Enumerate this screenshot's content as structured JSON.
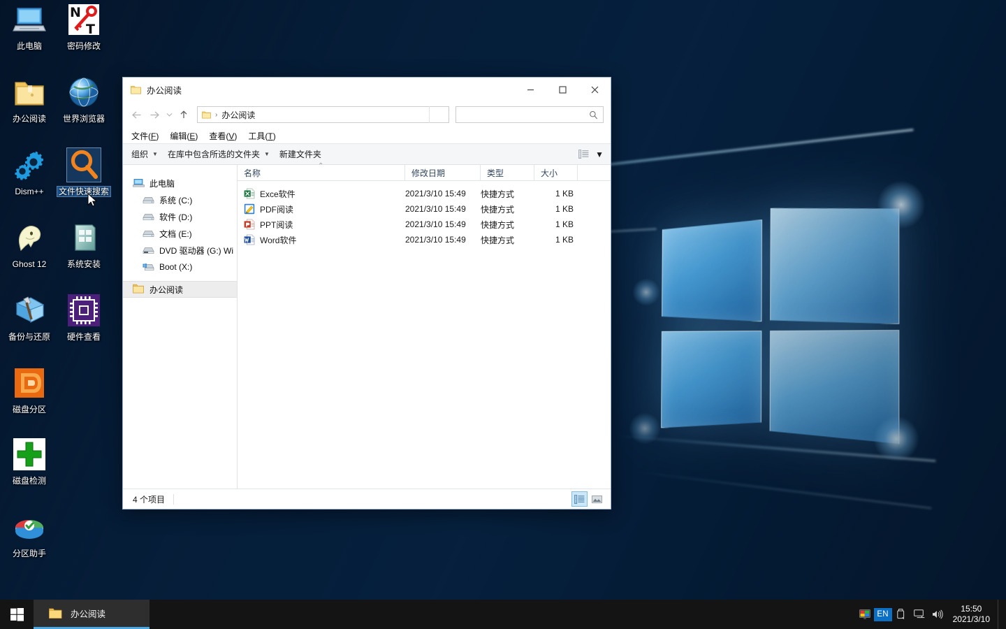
{
  "desktop": {
    "icons": [
      {
        "label": "此电脑",
        "icon": "this-pc-icon",
        "selected": false
      },
      {
        "label": "密码修改",
        "icon": "password-reset-icon",
        "selected": false
      },
      {
        "label": "办公阅读",
        "icon": "folder-icon",
        "selected": false
      },
      {
        "label": "世界浏览器",
        "icon": "globe-browser-icon",
        "selected": false
      },
      {
        "label": "Dism++",
        "icon": "gears-icon",
        "selected": false
      },
      {
        "label": "文件快速搜索",
        "icon": "magnifier-search-icon",
        "selected": true
      },
      {
        "label": "Ghost 12",
        "icon": "ghost-icon",
        "selected": false
      },
      {
        "label": "系统安装",
        "icon": "system-install-icon",
        "selected": false
      },
      {
        "label": "备份与还原",
        "icon": "backup-restore-hammer-icon",
        "selected": false
      },
      {
        "label": "硬件查看",
        "icon": "cpu-chip-icon",
        "selected": false
      },
      {
        "label": "磁盘分区",
        "icon": "disk-partition-icon",
        "selected": false
      },
      {
        "label": "磁盘检测",
        "icon": "green-cross-disk-check-icon",
        "selected": false
      },
      {
        "label": "分区助手",
        "icon": "partition-assistant-pie-icon",
        "selected": false
      }
    ]
  },
  "explorer": {
    "title": "办公阅读",
    "title_icon": "folder-icon",
    "window_controls": {
      "minimize": "—",
      "maximize": "□",
      "close": "✕"
    },
    "nav": {
      "back": "←",
      "forward": "→",
      "recent": "⌄",
      "up": "↑"
    },
    "address": {
      "icon": "folder-icon",
      "separator": "›",
      "crumb": "办公阅读"
    },
    "search": {
      "placeholder": "",
      "value": "",
      "icon": "search-icon"
    },
    "menubar": [
      {
        "text": "文件",
        "accel": "F"
      },
      {
        "text": "编辑",
        "accel": "E"
      },
      {
        "text": "查看",
        "accel": "V"
      },
      {
        "text": "工具",
        "accel": "T"
      }
    ],
    "commandbar": {
      "organize": "组织",
      "include_in_library": "在库中包含所选的文件夹",
      "new_folder": "新建文件夹",
      "caret": "▼",
      "view_icon": "view-options-icon"
    },
    "navpane": [
      {
        "label": "此电脑",
        "icon": "this-pc-icon",
        "indent": false,
        "selected": false
      },
      {
        "label": "系统 (C:)",
        "icon": "drive-icon",
        "indent": true,
        "selected": false
      },
      {
        "label": "软件 (D:)",
        "icon": "drive-icon",
        "indent": true,
        "selected": false
      },
      {
        "label": "文档 (E:)",
        "icon": "drive-icon",
        "indent": true,
        "selected": false
      },
      {
        "label": "DVD 驱动器 (G:) Wi",
        "icon": "dvd-drive-icon",
        "indent": true,
        "selected": false
      },
      {
        "label": "Boot (X:)",
        "icon": "boot-drive-icon",
        "indent": true,
        "selected": false
      },
      {
        "label": "办公阅读",
        "icon": "folder-icon",
        "indent": false,
        "selected": true
      }
    ],
    "columns": [
      {
        "key": "name",
        "label": "名称"
      },
      {
        "key": "date",
        "label": "修改日期"
      },
      {
        "key": "type",
        "label": "类型"
      },
      {
        "key": "size",
        "label": "大小"
      }
    ],
    "sort_indicator": "⌃",
    "files": [
      {
        "name": "Exce软件",
        "date": "2021/3/10 15:49",
        "type": "快捷方式",
        "size": "1 KB",
        "icon": "excel-icon"
      },
      {
        "name": "PDF阅读",
        "date": "2021/3/10 15:49",
        "type": "快捷方式",
        "size": "1 KB",
        "icon": "pdf-icon"
      },
      {
        "name": "PPT阅读",
        "date": "2021/3/10 15:49",
        "type": "快捷方式",
        "size": "1 KB",
        "icon": "powerpoint-icon"
      },
      {
        "name": "Word软件",
        "date": "2021/3/10 15:49",
        "type": "快捷方式",
        "size": "1 KB",
        "icon": "word-icon"
      }
    ],
    "status": {
      "count_text": "4 个项目",
      "view_details": "details-view-icon",
      "view_large": "large-icons-view-icon",
      "active_view": "details"
    }
  },
  "taskbar": {
    "start": "start-windows-icon",
    "tasks": [
      {
        "label": "办公阅读",
        "icon": "folder-icon",
        "active": true
      }
    ],
    "tray": [
      {
        "name": "color-picker-icon"
      },
      {
        "name": "language-indicator",
        "label": "EN"
      },
      {
        "name": "usb-eject-icon"
      },
      {
        "name": "network-monitor-icon"
      },
      {
        "name": "volume-icon"
      }
    ],
    "clock": {
      "time": "15:50",
      "date": "2021/3/10"
    }
  },
  "colors": {
    "accent": "#0b6fc4",
    "taskbar": "#141414",
    "task_underline": "#4aa8e0",
    "selection": "#cbe8fb",
    "window_bg": "#ffffff"
  }
}
